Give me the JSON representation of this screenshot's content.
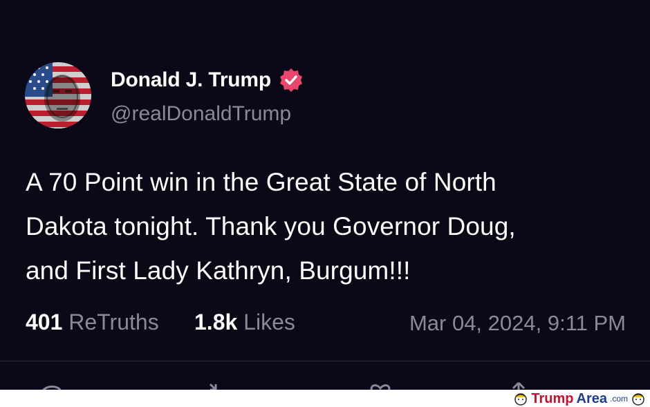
{
  "post": {
    "display_name": "Donald J. Trump",
    "handle": "@realDonaldTrump",
    "verified": true,
    "avatar_icon": "flag-portrait-avatar",
    "text_lines": [
      "A 70 Point win in the Great State of North",
      "Dakota tonight. Thank you Governor Doug,",
      "and First Lady Kathryn, Burgum!!!"
    ],
    "stats": {
      "retruths_count": "401",
      "retruths_label": "ReTruths",
      "likes_count": "1.8k",
      "likes_label": "Likes"
    },
    "timestamp": "Mar 04, 2024, 9:11 PM",
    "actions": [
      "reply-icon",
      "retruth-icon",
      "like-icon",
      "share-icon"
    ]
  },
  "colors": {
    "background": "#0b0817",
    "text": "#ffffff",
    "muted": "#8b8899",
    "verified_badge": "#e8466b"
  },
  "watermark": {
    "brand_part1": "Trump",
    "brand_part2": "Area",
    "suffix": ".com"
  }
}
